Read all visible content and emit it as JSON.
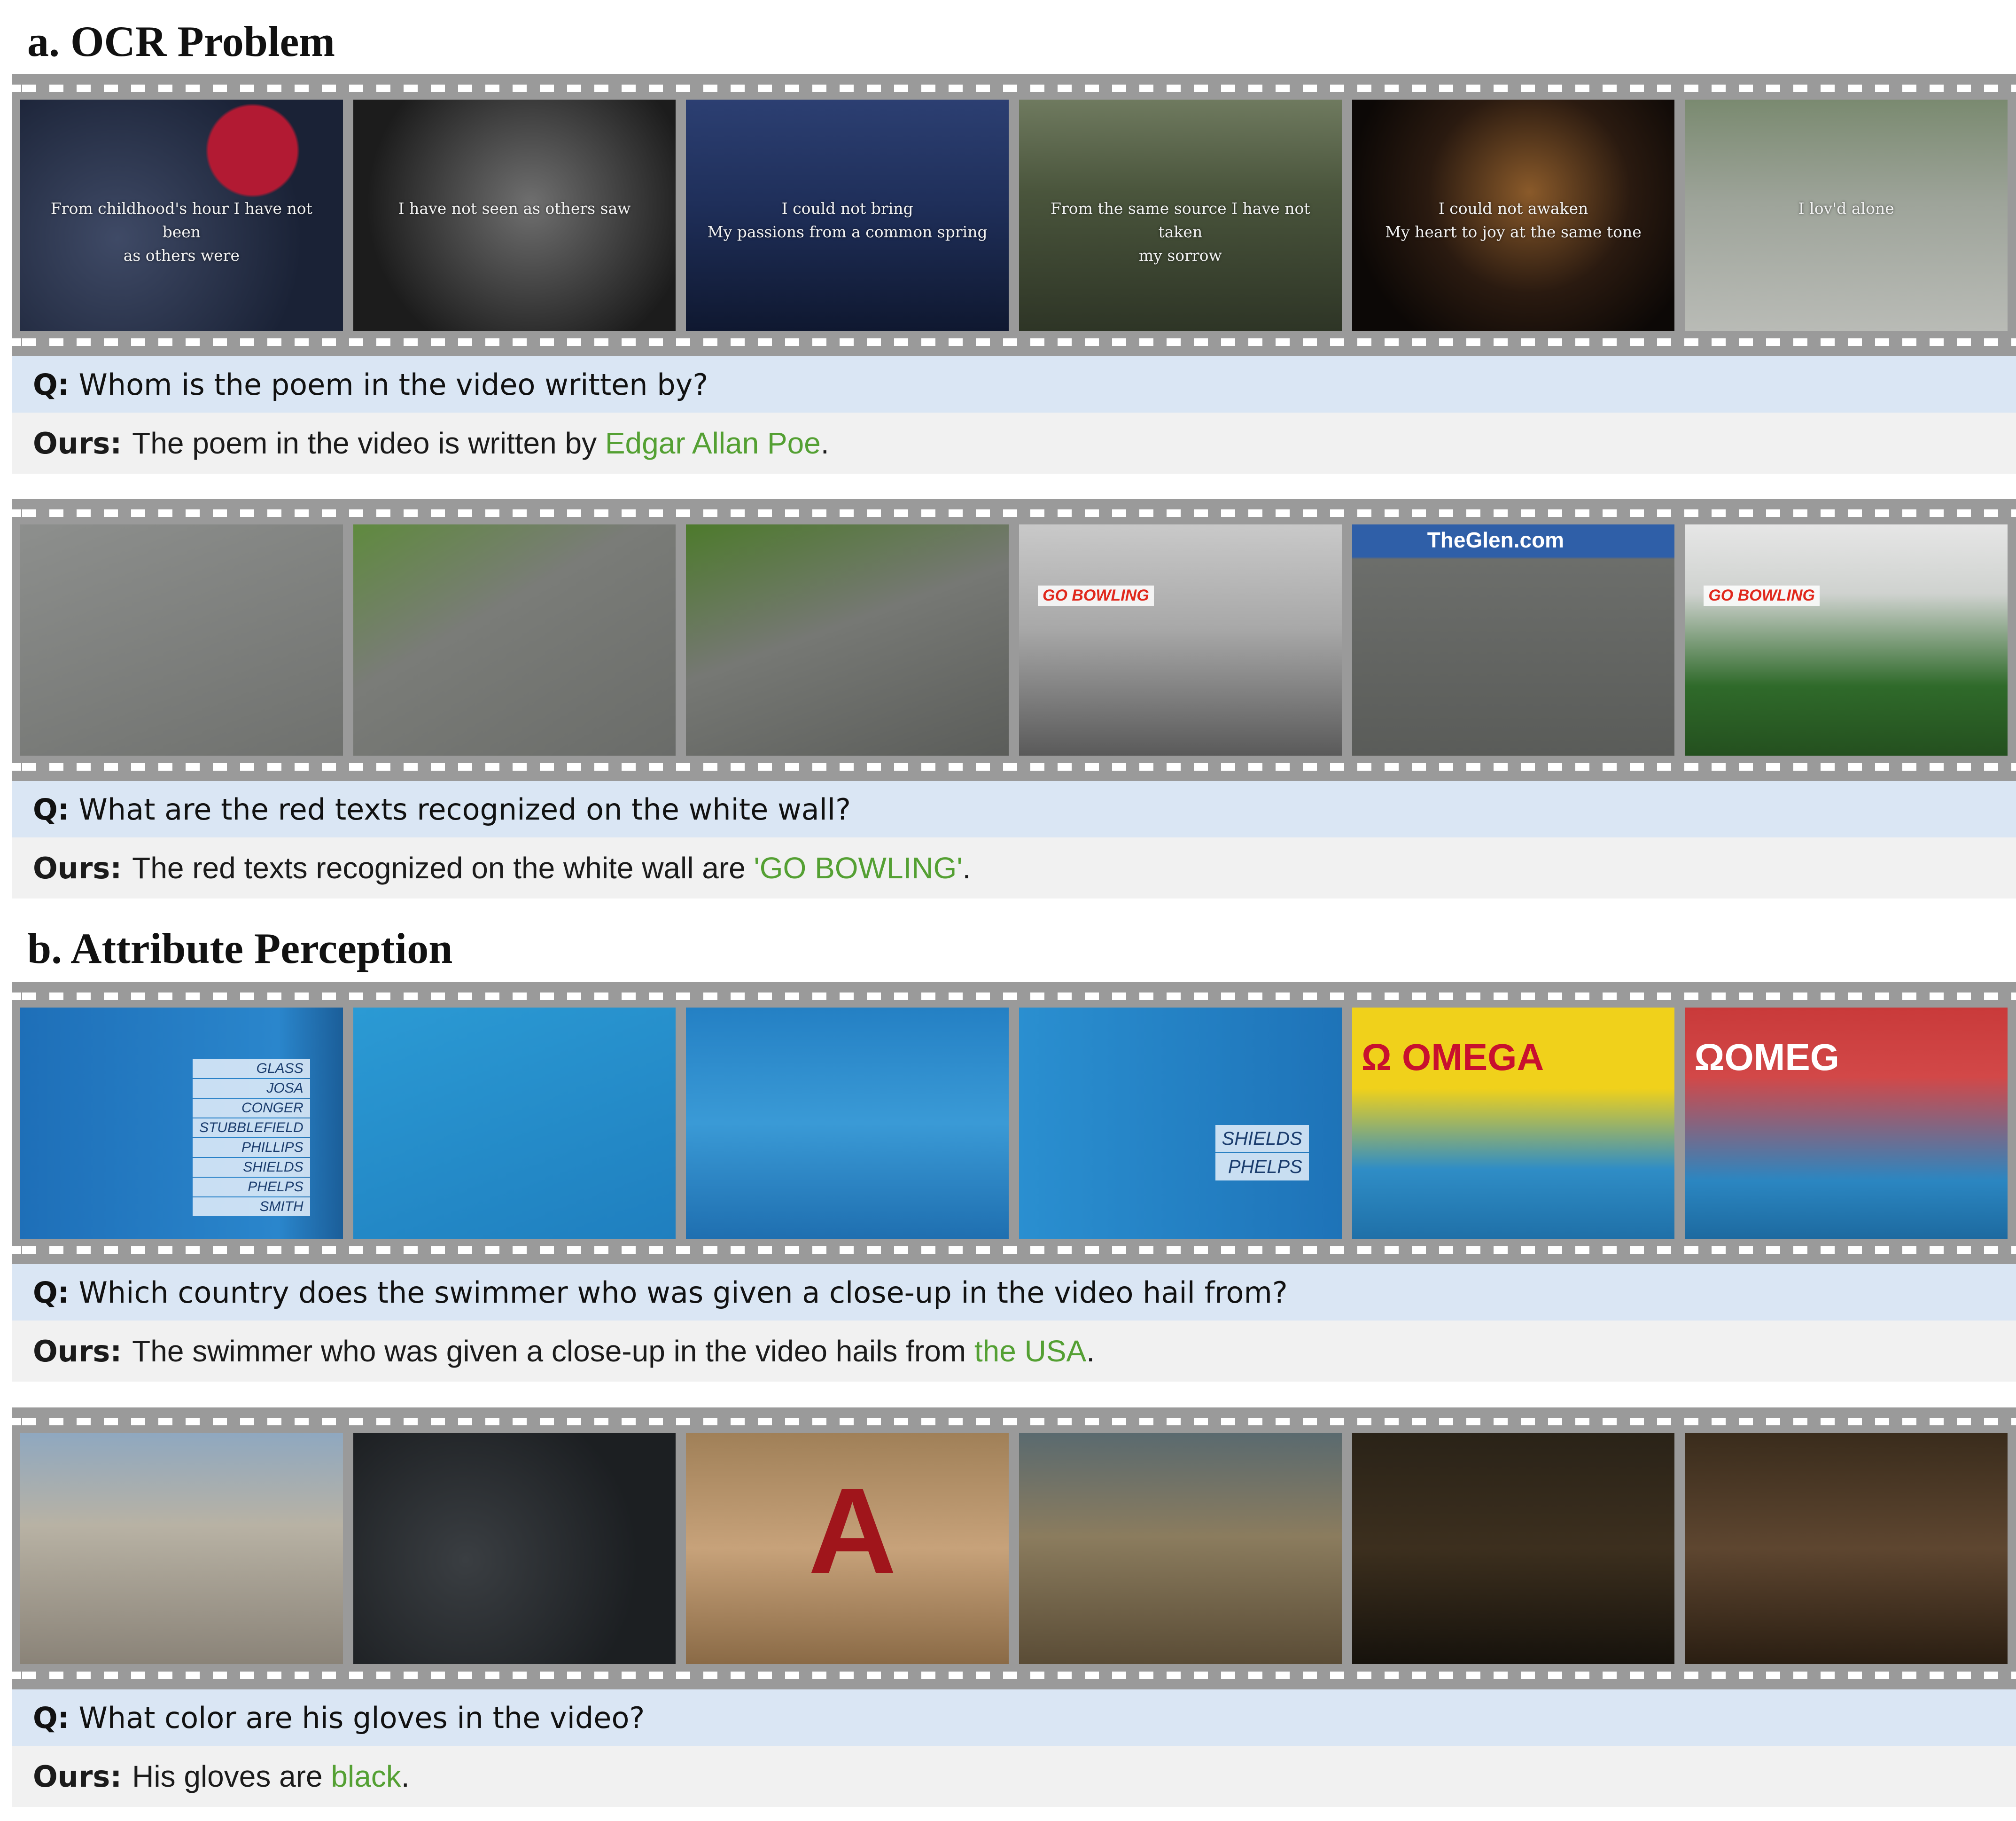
{
  "sections": [
    {
      "title": "a. OCR Problem",
      "items": [
        {
          "frames": [
            {
              "caption": "From childhood's hour I have not been\nas others were",
              "bg": "radial-gradient(circle at 72% 22%, #b21a33 0 15%, transparent 16%), radial-gradient(circle at 30% 60%, #3f4a66, #1a2236 70%)"
            },
            {
              "caption": "I have not seen as others saw",
              "bg": "radial-gradient(circle at 55% 45%, #6f6f6f, #1c1c1c 75%)"
            },
            {
              "caption": "I could not bring\nMy passions from a common spring",
              "bg": "linear-gradient(180deg, #2c3f72 0%, #1f2f5a 45%, #0f1830 100%)"
            },
            {
              "caption": "From the same source I have not taken\nmy sorrow",
              "bg": "linear-gradient(180deg, #6f7a5f 0%, #4a553c 40%, #2e3526 100%)"
            },
            {
              "caption": "I could not awaken\nMy heart to joy at the same tone",
              "bg": "radial-gradient(circle at 55% 40%, #8a5a2a, #2a1a10 45%, #0c0806 80%)"
            },
            {
              "caption": "I lov'd alone",
              "bg": "linear-gradient(180deg, #7a8a70 0%, #9ea49a 45%, #b9bbb6 100%)"
            }
          ],
          "question_label": "Q:",
          "question": "Whom is the poem in the video written by?",
          "answer_label": "Ours:",
          "answer_pre": "The poem in the video is written by",
          "answer_hl": "Edgar Allan Poe",
          "answer_post": "."
        },
        {
          "frames": [
            {
              "caption": "",
              "bg": "linear-gradient(160deg, #8d8f8d 0%, #6f716e 100%)"
            },
            {
              "caption": "",
              "bg": "linear-gradient(150deg, #5f8a3e 0%, #7a7c78 40%, #6a6c69 100%)"
            },
            {
              "caption": "",
              "bg": "linear-gradient(160deg, #4d7a2c 0%, #767874 45%, #5b5d5a 100%)"
            },
            {
              "caption": "",
              "bg": "linear-gradient(180deg, #c9c9c9 0%, #a8a8a8 45%, #5a5a5a 100%)",
              "tag": "GO BOWLING"
            },
            {
              "caption": "",
              "bg": "linear-gradient(180deg, #2f5fa8 0%, #2f5fa8 14%, #6c6e6b 15%, #5a5c59 100%)",
              "tag_blue": "TheGlen.com"
            },
            {
              "caption": "",
              "bg": "linear-gradient(180deg, #e6e6e6 0%, #cfd2cf 30%, #2f6a2a 70%, #24501f 100%)",
              "tag": "GO BOWLING"
            }
          ],
          "question_label": "Q:",
          "question": "What are the red texts recognized on the white wall?",
          "answer_label": "Ours:",
          "answer_pre": "The red texts recognized on the white wall are",
          "answer_hl": "'GO BOWLING'",
          "answer_post": "."
        }
      ]
    },
    {
      "title": "b. Attribute Perception",
      "items": [
        {
          "frames": [
            {
              "caption": "",
              "bg": "linear-gradient(90deg, #1e6fb8 0%, #2a86cc 80%, #1b5e99 100%)",
              "names": [
                "GLASS",
                "JOSA",
                "CONGER",
                "STUBBLEFIELD",
                "PHILLIPS",
                "SHIELDS",
                "PHELPS",
                "SMITH"
              ]
            },
            {
              "caption": "",
              "bg": "linear-gradient(160deg, #2b9ad4 0%, #1f7fbf 100%)"
            },
            {
              "caption": "",
              "bg": "linear-gradient(180deg, #2480c4 0%, #3a9ad6 50%, #1f6fb0 100%)"
            },
            {
              "caption": "",
              "bg": "linear-gradient(90deg, #2a8fd0 0%, #1e73b8 100%)",
              "names": [
                "SHIELDS",
                "PHELPS"
              ]
            },
            {
              "caption": "",
              "bg": "linear-gradient(180deg, #f0d11b 0%, #f0d11b 35%, #2f8dc6 70%, #1f70a8 100%)",
              "tag_brand": "Ω OMEGA"
            },
            {
              "caption": "",
              "bg": "linear-gradient(180deg, #c93a3a 0%, #d24848 30%, #2b86c1 75%, #1d6aa0 100%)",
              "tag_brand": "ΩOMEG"
            }
          ],
          "question_label": "Q:",
          "question": "Which country does the swimmer who was given a close-up in the video hail from?",
          "answer_label": "Ours:",
          "answer_pre": "The swimmer who was given a close-up in the video hails from",
          "answer_hl": "the USA",
          "answer_post": "."
        },
        {
          "frames": [
            {
              "caption": "",
              "bg": "linear-gradient(180deg, #8fa8c0 0%, #b8b2a4 40%, #8a8378 100%)"
            },
            {
              "caption": "",
              "bg": "radial-gradient(circle at 35% 55%, #3a3e42, #1c1f22 70%)"
            },
            {
              "caption": "",
              "bg": "linear-gradient(180deg, #a08058 0%, #c7a27a 50%, #8a6a46 100%)",
              "letter": "A"
            },
            {
              "caption": "",
              "bg": "linear-gradient(180deg, #5a6a6f 0%, #8b7c5e 45%, #5a4c36 100%)"
            },
            {
              "caption": "",
              "bg": "linear-gradient(180deg, #2a2318 0%, #3c2f1e 50%, #16120c 100%)"
            },
            {
              "caption": "",
              "bg": "linear-gradient(180deg, #3a2c1c 0%, #5e4630 50%, #2a1e12 100%)"
            }
          ],
          "question_label": "Q:",
          "question": "What color are his gloves in the video?",
          "answer_label": "Ours:",
          "answer_pre": "His gloves are",
          "answer_hl": "black",
          "answer_post": "."
        }
      ]
    }
  ],
  "colors": {
    "answer_highlight": "#54a033",
    "question_bg": "#dae6f4",
    "answer_bg": "#f1f1f1",
    "film": "#9a9a9a"
  }
}
